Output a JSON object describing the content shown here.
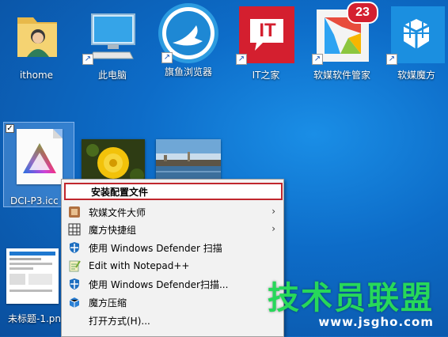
{
  "desktop_icons": [
    {
      "label": "ithome",
      "icon": "user-folder-icon"
    },
    {
      "label": "此电脑",
      "icon": "computer-icon"
    },
    {
      "label": "旗鱼浏览器",
      "icon": "sailfish-browser-icon"
    },
    {
      "label": "IT之家",
      "icon": "ithome-app-icon",
      "text": "IT"
    },
    {
      "label": "软媒软件管家",
      "icon": "software-manager-icon",
      "badge": "23"
    },
    {
      "label": "软媒魔方",
      "icon": "cube-icon"
    }
  ],
  "selected_file": {
    "label": "DCI-P3.icc",
    "checked": "✓"
  },
  "bottom_file": {
    "label": "未标题-1.pn"
  },
  "context_menu": {
    "items": [
      {
        "label": "安装配置文件",
        "icon": "",
        "highlighted": true
      },
      {
        "label": "软媒文件大师",
        "icon": "file-master-icon",
        "submenu": "›"
      },
      {
        "label": "魔方快捷组",
        "icon": "grid-icon",
        "submenu": "›"
      },
      {
        "label": "使用 Windows Defender 扫描",
        "icon": "defender-shield-icon"
      },
      {
        "label": "Edit with Notepad++",
        "icon": "notepad-plus-icon"
      },
      {
        "label": "使用 Windows Defender扫描...",
        "icon": "defender-shield-icon"
      },
      {
        "label": "魔方压缩",
        "icon": "compress-cube-icon"
      },
      {
        "label": "打开方式(H)...",
        "icon": ""
      }
    ]
  },
  "watermark": {
    "title": "技术员联盟",
    "url": "www.jsgho.com"
  },
  "colors": {
    "highlight_border": "#c0262d",
    "watermark_green": "#27d85a",
    "desktop_blue": "#0d6cc8"
  }
}
